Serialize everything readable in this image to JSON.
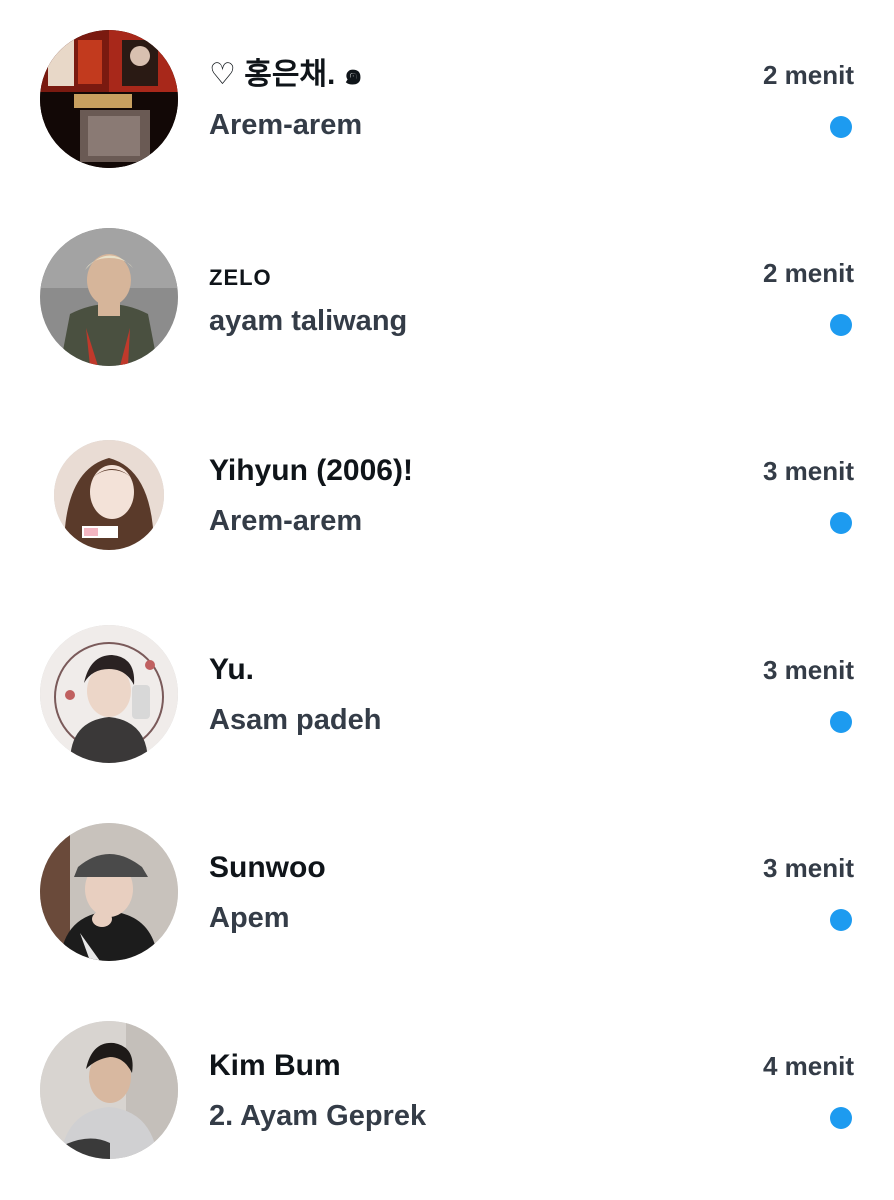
{
  "conversations": [
    {
      "name": "♡ 홍은채. ๑",
      "message": "Arem-arem",
      "time": "2 menit",
      "unread": true,
      "avatar_icon": "collage-avatar-icon"
    },
    {
      "name": "ZELO",
      "message": "ayam taliwang",
      "time": "2 menit",
      "unread": true,
      "avatar_icon": "person-avatar-icon"
    },
    {
      "name": "Yihyun (2006)!",
      "message": "Arem-arem",
      "time": "3 menit",
      "unread": true,
      "avatar_icon": "person-avatar-icon"
    },
    {
      "name": "Yu.",
      "message": "Asam padeh",
      "time": "3 menit",
      "unread": true,
      "avatar_icon": "person-avatar-icon"
    },
    {
      "name": "Sunwoo",
      "message": "Apem",
      "time": "3 menit",
      "unread": true,
      "avatar_icon": "person-avatar-icon"
    },
    {
      "name": "Kim Bum",
      "message": "2. Ayam Geprek",
      "time": "4 menit",
      "unread": true,
      "avatar_icon": "person-avatar-icon"
    }
  ],
  "colors": {
    "unread_dot": "#1d9bf0",
    "name_text": "#0f1419",
    "secondary_text": "#343c47"
  }
}
